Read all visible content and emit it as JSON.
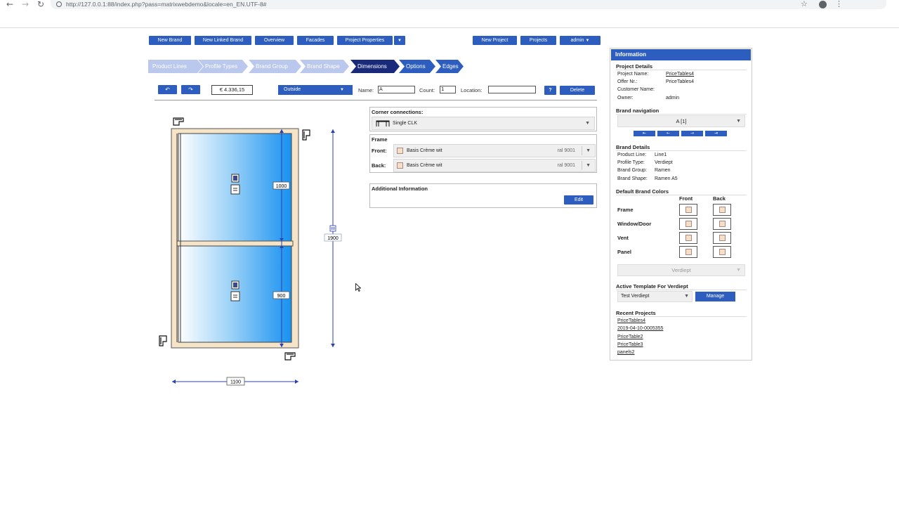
{
  "browser": {
    "url": "http://127.0.0.1:88/index.php?pass=matrixwebdemo&locale=en_EN.UTF-8#"
  },
  "topbar": {
    "new_brand": "New Brand",
    "new_linked_brand": "New Linked Brand",
    "overview": "Overview",
    "facades": "Facades",
    "project_properties": "Project Properties",
    "new_project": "New Project",
    "projects": "Projects",
    "admin": "admin"
  },
  "steps": [
    {
      "label": "Product Lines",
      "state": "done"
    },
    {
      "label": "Profile Types",
      "state": "done"
    },
    {
      "label": "Brand Group",
      "state": "done"
    },
    {
      "label": "Brand Shape",
      "state": "done"
    },
    {
      "label": "Dimensions",
      "state": "active"
    },
    {
      "label": "Options",
      "state": "todo"
    },
    {
      "label": "Edges",
      "state": "todo"
    }
  ],
  "toolbar": {
    "price": "€ 4.336,15",
    "view_select": "Outside",
    "name_label": "Name:",
    "name_value": "A",
    "count_label": "Count:",
    "count_value": "1",
    "location_label": "Location:",
    "location_value": "",
    "help_label": "?",
    "delete_label": "Delete"
  },
  "drawing": {
    "dim_top_pane": "1000",
    "dim_bottom_pane": "900",
    "dim_total_height": "1900",
    "dim_width": "1100"
  },
  "corner": {
    "title": "Corner connections:",
    "value": "Single CLK"
  },
  "frame": {
    "title": "Frame",
    "front_label": "Front:",
    "front_color": "Basis Crème wit",
    "front_ral": "ral 9001",
    "back_label": "Back:",
    "back_color": "Basis Crème wit",
    "back_ral": "ral 9001"
  },
  "additional": {
    "title": "Additional Information",
    "edit_label": "Edit"
  },
  "info": {
    "header": "Information",
    "project_details": {
      "title": "Project Details",
      "project_name_label": "Project Name:",
      "project_name": "PriceTables4",
      "offer_label": "Offer Nr.:",
      "offer": "PriceTables4",
      "customer_label": "Customer Name:",
      "customer": "",
      "owner_label": "Owner:",
      "owner": "admin"
    },
    "brand_navigation": {
      "title": "Brand navigation",
      "selected": "A [1]"
    },
    "brand_details": {
      "title": "Brand Details",
      "product_line_label": "Product Line:",
      "product_line": "Line1",
      "profile_type_label": "Profile Type:",
      "profile_type": "Verdiept",
      "brand_group_label": "Brand Group:",
      "brand_group": "Ramen",
      "brand_shape_label": "Brand Shape:",
      "brand_shape": "Ramen A5"
    },
    "default_colors": {
      "title": "Default Brand Colors",
      "front": "Front",
      "back": "Back",
      "rows": [
        "Frame",
        "Window/Door",
        "Vent",
        "Panel"
      ]
    },
    "profile_select": "Verdiept",
    "active_template": {
      "title": "Active Template For Verdiept",
      "value": "Test Verdiept",
      "manage": "Manage"
    },
    "recent": {
      "title": "Recent Projects",
      "items": [
        "PriceTables4",
        "2019-04-10-0005355",
        "PriceTable2",
        "PriceTable3",
        "panels2"
      ]
    }
  }
}
